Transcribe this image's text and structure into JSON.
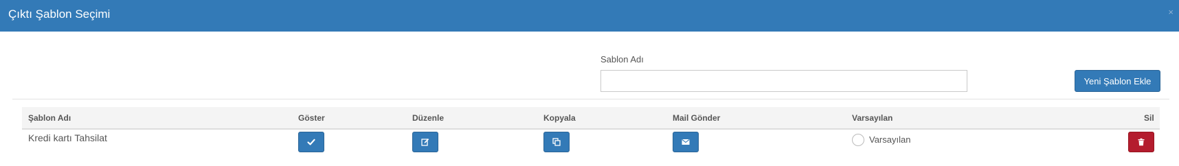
{
  "modal": {
    "title": "Çıktı Şablon Seçimi",
    "close_glyph": "×"
  },
  "form": {
    "label": "Sablon Adı",
    "value": "",
    "placeholder": "",
    "add_button_label": "Yeni Şablon Ekle"
  },
  "table": {
    "headers": [
      "Şablon Adı",
      "Göster",
      "Düzenle",
      "Kopyala",
      "Mail Gönder",
      "Varsayılan",
      "Sil"
    ],
    "rows": [
      {
        "name": "Kredi kartı Tahsilat",
        "default_label": "Varsayılan",
        "default_selected": false
      }
    ]
  },
  "icons": {
    "show": "check-icon",
    "edit": "edit-icon",
    "copy": "copy-icon",
    "mail": "envelope-icon",
    "delete": "trash-icon"
  },
  "colors": {
    "primary": "#337ab7",
    "danger": "#b41c2e"
  }
}
